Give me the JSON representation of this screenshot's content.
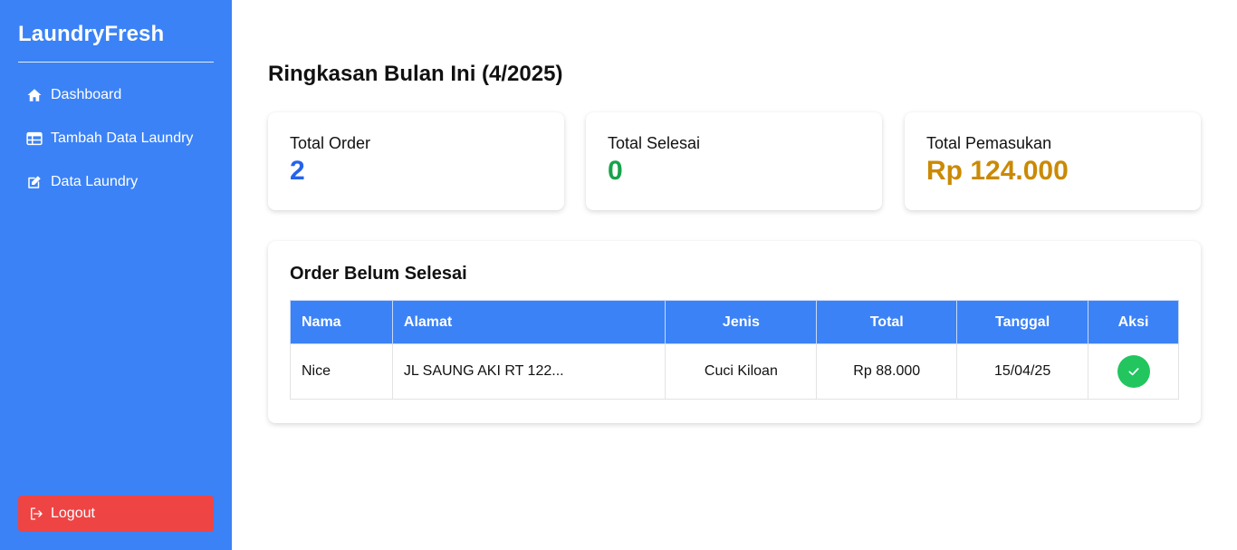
{
  "brand": "LaundryFresh",
  "sidebar": {
    "items": [
      {
        "label": "Dashboard",
        "icon": "home-icon"
      },
      {
        "label": "Tambah Data Laundry",
        "icon": "table-icon"
      },
      {
        "label": "Data Laundry",
        "icon": "edit-icon"
      }
    ],
    "logout_label": "Logout"
  },
  "summary": {
    "title": "Ringkasan Bulan Ini (4/2025)",
    "cards": [
      {
        "label": "Total Order",
        "value": "2",
        "color": "#2563eb"
      },
      {
        "label": "Total Selesai",
        "value": "0",
        "color": "#16a34a"
      },
      {
        "label": "Total Pemasukan",
        "value": "Rp 124.000",
        "color": "#ca8a04"
      }
    ]
  },
  "orders": {
    "title": "Order Belum Selesai",
    "columns": [
      "Nama",
      "Alamat",
      "Jenis",
      "Total",
      "Tanggal",
      "Aksi"
    ],
    "rows": [
      {
        "nama": "Nice",
        "alamat": "JL SAUNG AKI RT 122...",
        "jenis": "Cuci Kiloan",
        "total": "Rp 88.000",
        "tanggal": "15/04/25",
        "action_icon": "check-icon"
      }
    ]
  },
  "colors": {
    "sidebar": "#3b82f6",
    "logout": "#ef4444",
    "table_header": "#3b82f6",
    "success": "#22c55e"
  }
}
